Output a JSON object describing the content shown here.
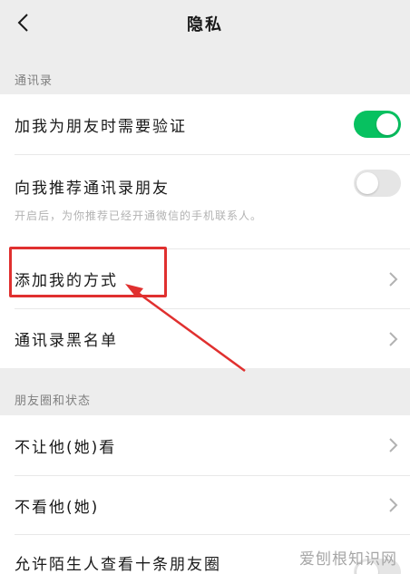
{
  "header": {
    "title": "隐私"
  },
  "sections": {
    "contacts": "通讯录",
    "moments": "朋友圈和状态"
  },
  "rows": {
    "verify": {
      "label": "加我为朋友时需要验证",
      "enabled": true
    },
    "recommend": {
      "label": "向我推荐通讯录朋友",
      "enabled": false,
      "hint": "开启后，为你推荐已经开通微信的手机联系人。"
    },
    "add_methods": {
      "label": "添加我的方式"
    },
    "blacklist": {
      "label": "通讯录黑名单"
    },
    "hide_from": {
      "label": "不让他(她)看"
    },
    "dont_see": {
      "label": "不看他(她)"
    },
    "stranger_ten": {
      "label": "允许陌生人查看十条朋友圈",
      "enabled": false
    }
  },
  "watermark": "爱刨根知识网",
  "colors": {
    "toggle_on": "#07c160",
    "annotation": "#e0302f"
  }
}
